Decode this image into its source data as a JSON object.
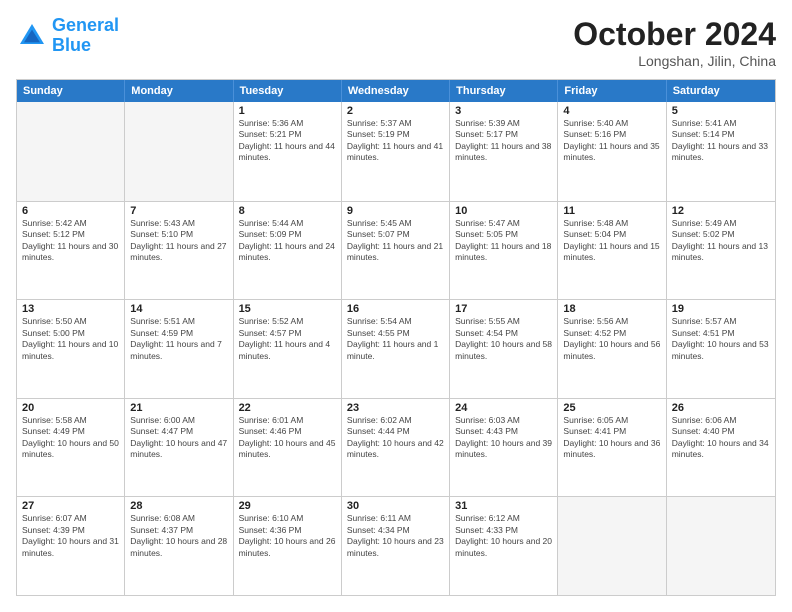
{
  "header": {
    "logo_general": "General",
    "logo_blue": "Blue",
    "month_title": "October 2024",
    "location": "Longshan, Jilin, China"
  },
  "calendar": {
    "days_of_week": [
      "Sunday",
      "Monday",
      "Tuesday",
      "Wednesday",
      "Thursday",
      "Friday",
      "Saturday"
    ],
    "weeks": [
      [
        {
          "day": "",
          "sunrise": "",
          "sunset": "",
          "daylight": "",
          "empty": true
        },
        {
          "day": "",
          "sunrise": "",
          "sunset": "",
          "daylight": "",
          "empty": true
        },
        {
          "day": "1",
          "sunrise": "Sunrise: 5:36 AM",
          "sunset": "Sunset: 5:21 PM",
          "daylight": "Daylight: 11 hours and 44 minutes."
        },
        {
          "day": "2",
          "sunrise": "Sunrise: 5:37 AM",
          "sunset": "Sunset: 5:19 PM",
          "daylight": "Daylight: 11 hours and 41 minutes."
        },
        {
          "day": "3",
          "sunrise": "Sunrise: 5:39 AM",
          "sunset": "Sunset: 5:17 PM",
          "daylight": "Daylight: 11 hours and 38 minutes."
        },
        {
          "day": "4",
          "sunrise": "Sunrise: 5:40 AM",
          "sunset": "Sunset: 5:16 PM",
          "daylight": "Daylight: 11 hours and 35 minutes."
        },
        {
          "day": "5",
          "sunrise": "Sunrise: 5:41 AM",
          "sunset": "Sunset: 5:14 PM",
          "daylight": "Daylight: 11 hours and 33 minutes."
        }
      ],
      [
        {
          "day": "6",
          "sunrise": "Sunrise: 5:42 AM",
          "sunset": "Sunset: 5:12 PM",
          "daylight": "Daylight: 11 hours and 30 minutes."
        },
        {
          "day": "7",
          "sunrise": "Sunrise: 5:43 AM",
          "sunset": "Sunset: 5:10 PM",
          "daylight": "Daylight: 11 hours and 27 minutes."
        },
        {
          "day": "8",
          "sunrise": "Sunrise: 5:44 AM",
          "sunset": "Sunset: 5:09 PM",
          "daylight": "Daylight: 11 hours and 24 minutes."
        },
        {
          "day": "9",
          "sunrise": "Sunrise: 5:45 AM",
          "sunset": "Sunset: 5:07 PM",
          "daylight": "Daylight: 11 hours and 21 minutes."
        },
        {
          "day": "10",
          "sunrise": "Sunrise: 5:47 AM",
          "sunset": "Sunset: 5:05 PM",
          "daylight": "Daylight: 11 hours and 18 minutes."
        },
        {
          "day": "11",
          "sunrise": "Sunrise: 5:48 AM",
          "sunset": "Sunset: 5:04 PM",
          "daylight": "Daylight: 11 hours and 15 minutes."
        },
        {
          "day": "12",
          "sunrise": "Sunrise: 5:49 AM",
          "sunset": "Sunset: 5:02 PM",
          "daylight": "Daylight: 11 hours and 13 minutes."
        }
      ],
      [
        {
          "day": "13",
          "sunrise": "Sunrise: 5:50 AM",
          "sunset": "Sunset: 5:00 PM",
          "daylight": "Daylight: 11 hours and 10 minutes."
        },
        {
          "day": "14",
          "sunrise": "Sunrise: 5:51 AM",
          "sunset": "Sunset: 4:59 PM",
          "daylight": "Daylight: 11 hours and 7 minutes."
        },
        {
          "day": "15",
          "sunrise": "Sunrise: 5:52 AM",
          "sunset": "Sunset: 4:57 PM",
          "daylight": "Daylight: 11 hours and 4 minutes."
        },
        {
          "day": "16",
          "sunrise": "Sunrise: 5:54 AM",
          "sunset": "Sunset: 4:55 PM",
          "daylight": "Daylight: 11 hours and 1 minute."
        },
        {
          "day": "17",
          "sunrise": "Sunrise: 5:55 AM",
          "sunset": "Sunset: 4:54 PM",
          "daylight": "Daylight: 10 hours and 58 minutes."
        },
        {
          "day": "18",
          "sunrise": "Sunrise: 5:56 AM",
          "sunset": "Sunset: 4:52 PM",
          "daylight": "Daylight: 10 hours and 56 minutes."
        },
        {
          "day": "19",
          "sunrise": "Sunrise: 5:57 AM",
          "sunset": "Sunset: 4:51 PM",
          "daylight": "Daylight: 10 hours and 53 minutes."
        }
      ],
      [
        {
          "day": "20",
          "sunrise": "Sunrise: 5:58 AM",
          "sunset": "Sunset: 4:49 PM",
          "daylight": "Daylight: 10 hours and 50 minutes."
        },
        {
          "day": "21",
          "sunrise": "Sunrise: 6:00 AM",
          "sunset": "Sunset: 4:47 PM",
          "daylight": "Daylight: 10 hours and 47 minutes."
        },
        {
          "day": "22",
          "sunrise": "Sunrise: 6:01 AM",
          "sunset": "Sunset: 4:46 PM",
          "daylight": "Daylight: 10 hours and 45 minutes."
        },
        {
          "day": "23",
          "sunrise": "Sunrise: 6:02 AM",
          "sunset": "Sunset: 4:44 PM",
          "daylight": "Daylight: 10 hours and 42 minutes."
        },
        {
          "day": "24",
          "sunrise": "Sunrise: 6:03 AM",
          "sunset": "Sunset: 4:43 PM",
          "daylight": "Daylight: 10 hours and 39 minutes."
        },
        {
          "day": "25",
          "sunrise": "Sunrise: 6:05 AM",
          "sunset": "Sunset: 4:41 PM",
          "daylight": "Daylight: 10 hours and 36 minutes."
        },
        {
          "day": "26",
          "sunrise": "Sunrise: 6:06 AM",
          "sunset": "Sunset: 4:40 PM",
          "daylight": "Daylight: 10 hours and 34 minutes."
        }
      ],
      [
        {
          "day": "27",
          "sunrise": "Sunrise: 6:07 AM",
          "sunset": "Sunset: 4:39 PM",
          "daylight": "Daylight: 10 hours and 31 minutes."
        },
        {
          "day": "28",
          "sunrise": "Sunrise: 6:08 AM",
          "sunset": "Sunset: 4:37 PM",
          "daylight": "Daylight: 10 hours and 28 minutes."
        },
        {
          "day": "29",
          "sunrise": "Sunrise: 6:10 AM",
          "sunset": "Sunset: 4:36 PM",
          "daylight": "Daylight: 10 hours and 26 minutes."
        },
        {
          "day": "30",
          "sunrise": "Sunrise: 6:11 AM",
          "sunset": "Sunset: 4:34 PM",
          "daylight": "Daylight: 10 hours and 23 minutes."
        },
        {
          "day": "31",
          "sunrise": "Sunrise: 6:12 AM",
          "sunset": "Sunset: 4:33 PM",
          "daylight": "Daylight: 10 hours and 20 minutes."
        },
        {
          "day": "",
          "sunrise": "",
          "sunset": "",
          "daylight": "",
          "empty": true
        },
        {
          "day": "",
          "sunrise": "",
          "sunset": "",
          "daylight": "",
          "empty": true
        }
      ]
    ]
  }
}
